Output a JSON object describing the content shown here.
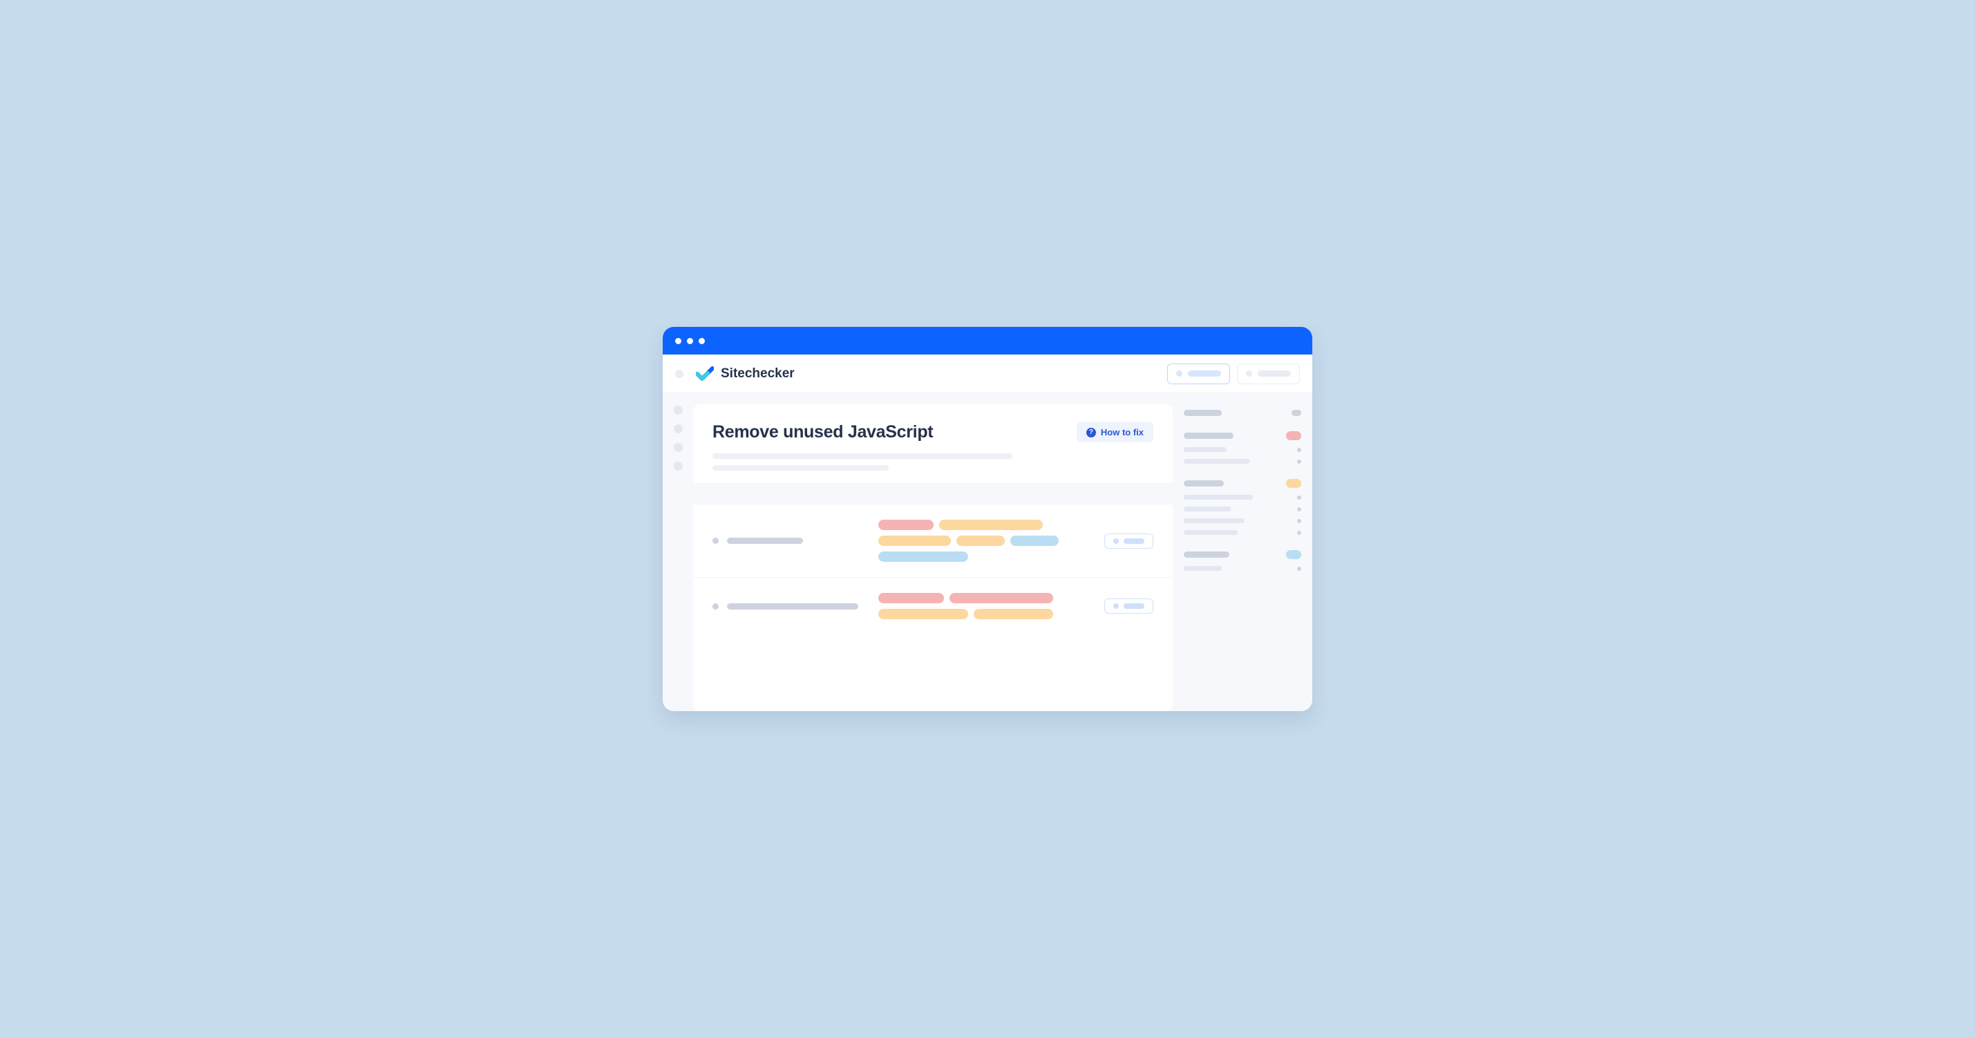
{
  "brand": {
    "name": "Sitechecker"
  },
  "page": {
    "title": "Remove unused JavaScript",
    "how_to_fix_label": "How to fix"
  },
  "colors": {
    "accent": "#0d63fd",
    "tag_red": "#f5b3b3",
    "tag_orange": "#fcd79e",
    "tag_blue": "#b9ddf3"
  }
}
